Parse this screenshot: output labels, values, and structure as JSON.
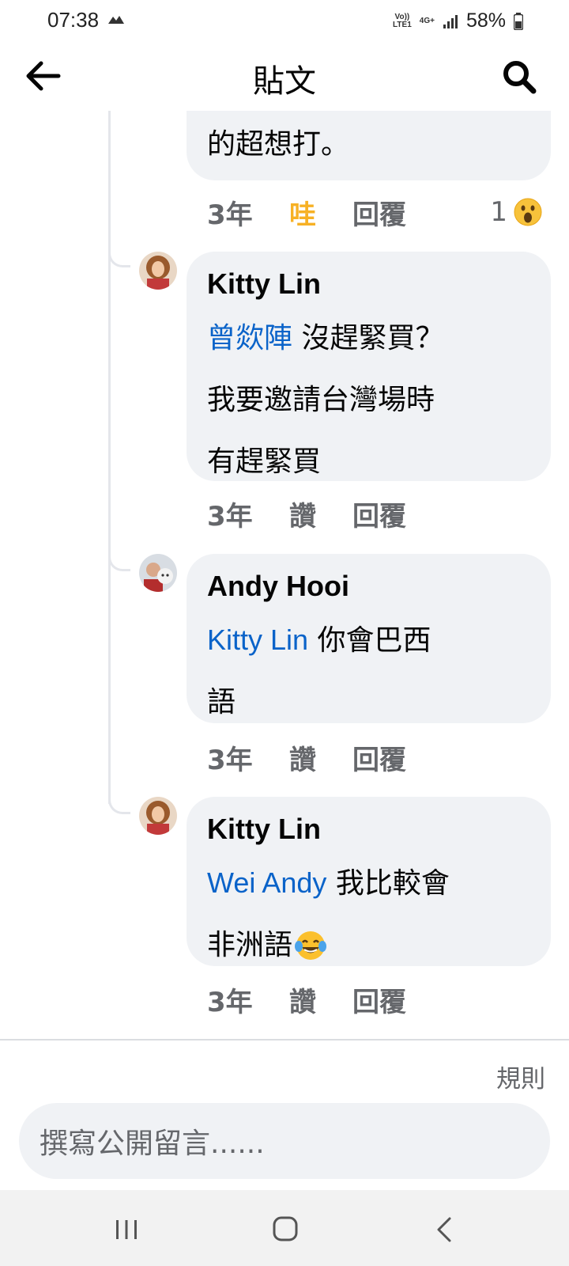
{
  "status": {
    "time": "07:38",
    "net_volte": "Vo)) LTE1",
    "net_4g": "4G+",
    "battery": "58%"
  },
  "header": {
    "title": "貼文",
    "back_icon": "arrow-left-icon",
    "search_icon": "search-icon"
  },
  "comments": [
    {
      "text": "的超想打。",
      "time": "3年",
      "like_label": "哇",
      "reply_label": "回覆",
      "reaction_count": "1",
      "reaction_icon": "wow-face-icon"
    },
    {
      "author": "Kitty Lin",
      "mention": "曾欻陣",
      "line1": " 沒趕緊買？",
      "line2": "我要邀請台灣場時",
      "line3": "有趕緊買",
      "time": "3年",
      "like_label": "讚",
      "reply_label": "回覆"
    },
    {
      "author": "Andy Hooi",
      "mention": "Kitty Lin",
      "line1": " 你會巴西",
      "line2": "語",
      "time": "3年",
      "like_label": "讚",
      "reply_label": "回覆"
    },
    {
      "author": "Kitty Lin",
      "mention": "Wei Andy",
      "line1": " 我比較會",
      "line2": "非洲語",
      "emoji": "tears-of-joy-emoji",
      "time": "3年",
      "like_label": "讚",
      "reply_label": "回覆"
    }
  ],
  "footer": {
    "rules_label": "規則",
    "composer_placeholder": "撰寫公開留言......"
  },
  "navbar": {
    "recent_icon": "recent-apps-icon",
    "home_icon": "home-icon",
    "back_icon": "back-chevron-icon"
  }
}
